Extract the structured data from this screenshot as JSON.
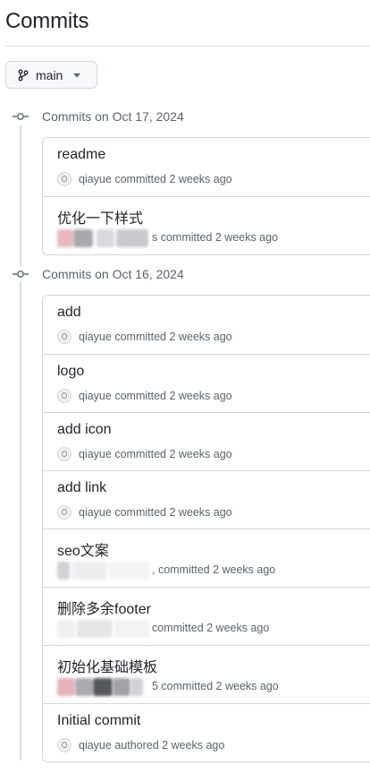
{
  "page": {
    "title": "Commits"
  },
  "branch": {
    "label": "main"
  },
  "groups": [
    {
      "heading": "Commits on Oct 17, 2024",
      "commits": [
        {
          "message": "readme",
          "author": "qiayue",
          "action_text": "committed 2 weeks ago"
        },
        {
          "message": "优化一下样式",
          "author": "",
          "action_text": "s committed 2 weeks ago"
        }
      ]
    },
    {
      "heading": "Commits on Oct 16, 2024",
      "commits": [
        {
          "message": "add",
          "author": "qiayue",
          "action_text": "committed 2 weeks ago"
        },
        {
          "message": "logo",
          "author": "qiayue",
          "action_text": "committed 2 weeks ago"
        },
        {
          "message": "add icon",
          "author": "qiayue",
          "action_text": "committed 2 weeks ago"
        },
        {
          "message": "add link",
          "author": "qiayue",
          "action_text": "committed 2 weeks ago"
        },
        {
          "message": "seo文案",
          "author": "",
          "action_text": ", committed 2 weeks ago"
        },
        {
          "message": "删除多余footer",
          "author": "",
          "action_text": "committed 2 weeks ago"
        },
        {
          "message": "初始化基础模板",
          "author": "",
          "action_text": "5 committed 2 weeks ago"
        },
        {
          "message": "Initial commit",
          "author": "qiayue",
          "action_text": "authored 2 weeks ago"
        }
      ]
    }
  ],
  "icons": {
    "branch": "git-branch-icon",
    "caret": "triangle-down-icon",
    "commit": "git-commit-icon"
  }
}
